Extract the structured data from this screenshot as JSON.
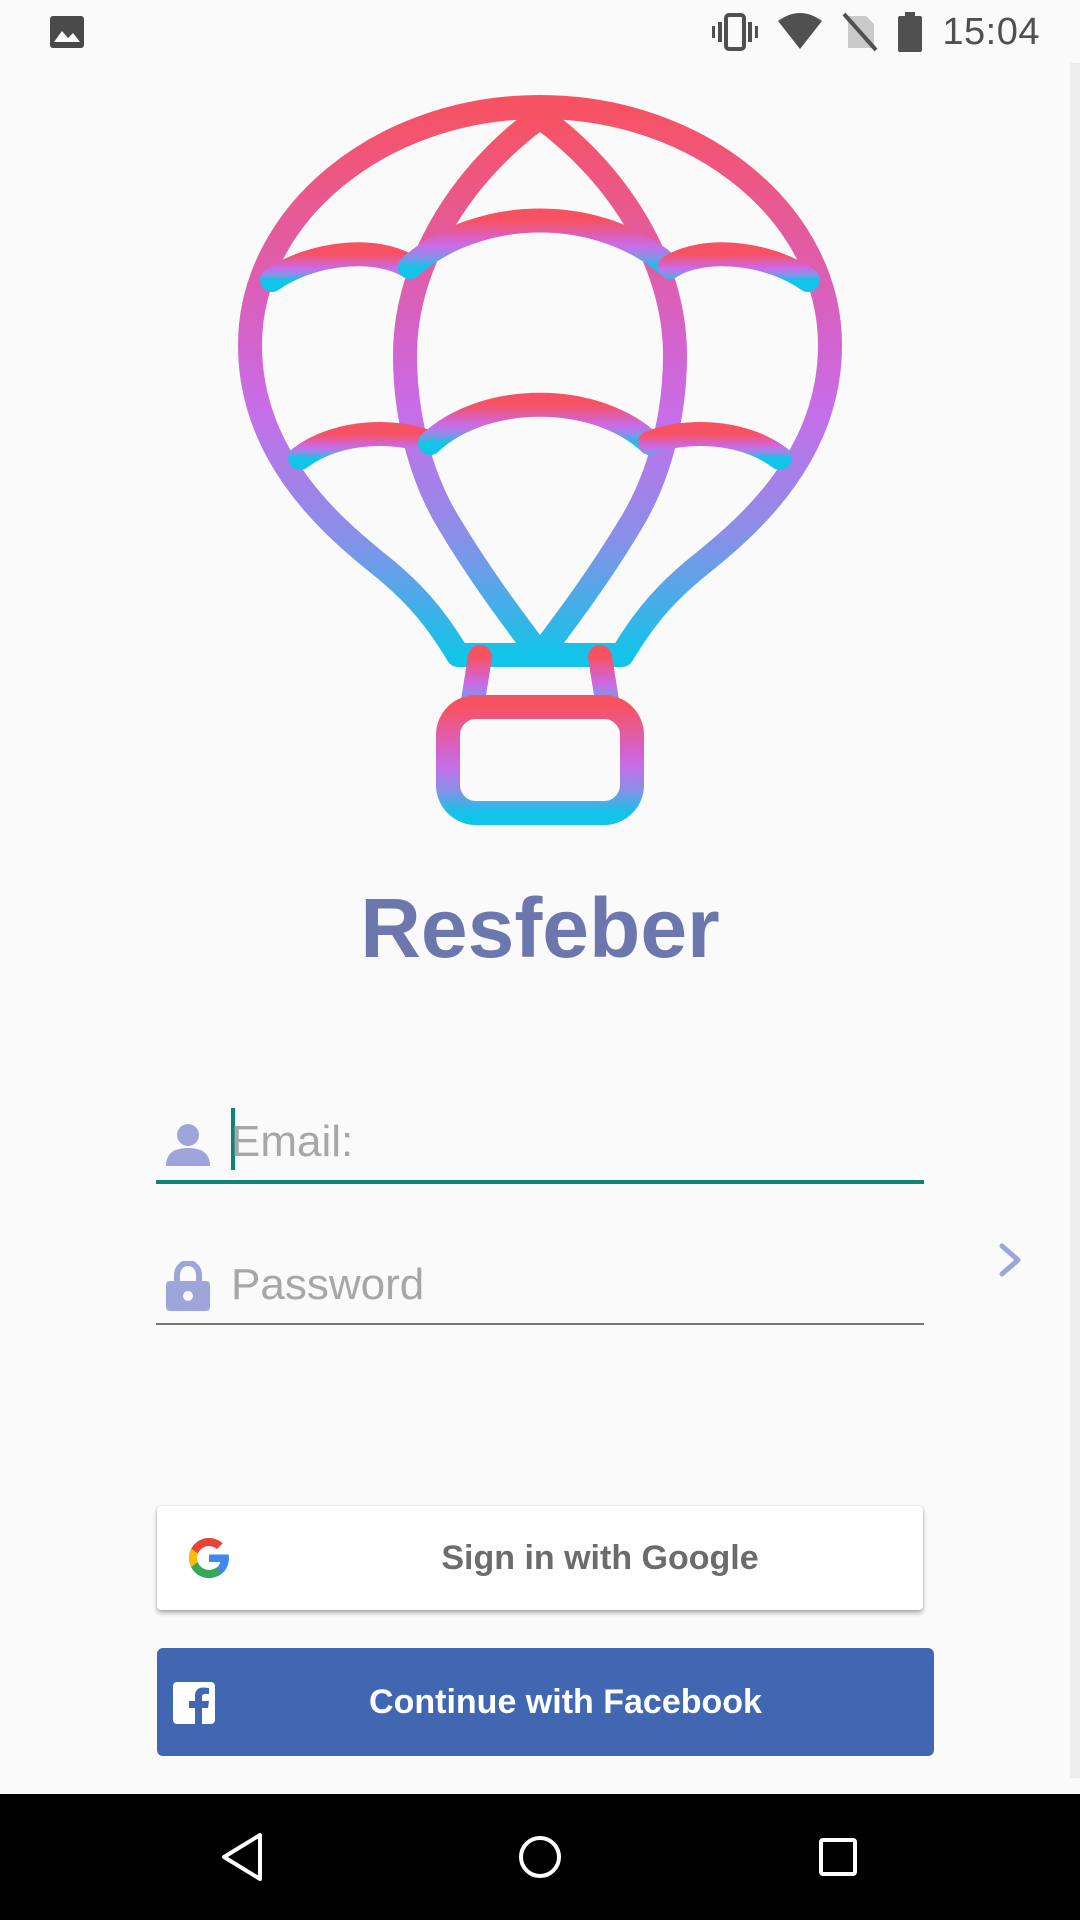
{
  "status_bar": {
    "time": "15:04",
    "icons": [
      "gallery-icon",
      "vibrate-icon",
      "wifi-icon",
      "no-sim-icon",
      "battery-icon"
    ]
  },
  "app": {
    "title": "Resfeber",
    "logo": "hot-air-balloon-logo",
    "title_color": "#6c77ad",
    "gradient_colors": [
      "#f75263",
      "#c86de8",
      "#12c4e8"
    ]
  },
  "form": {
    "email": {
      "placeholder": "Email:",
      "value": "",
      "icon": "person-icon",
      "focused": true
    },
    "password": {
      "placeholder": "Password",
      "value": "",
      "icon": "lock-icon"
    },
    "submit_icon": "chevron-right-icon"
  },
  "social": {
    "google_label": "Sign in with Google",
    "facebook_label": "Continue with Facebook",
    "facebook_color": "#4267b2"
  },
  "nav": {
    "buttons": [
      "back-icon",
      "home-icon",
      "recents-icon"
    ]
  }
}
